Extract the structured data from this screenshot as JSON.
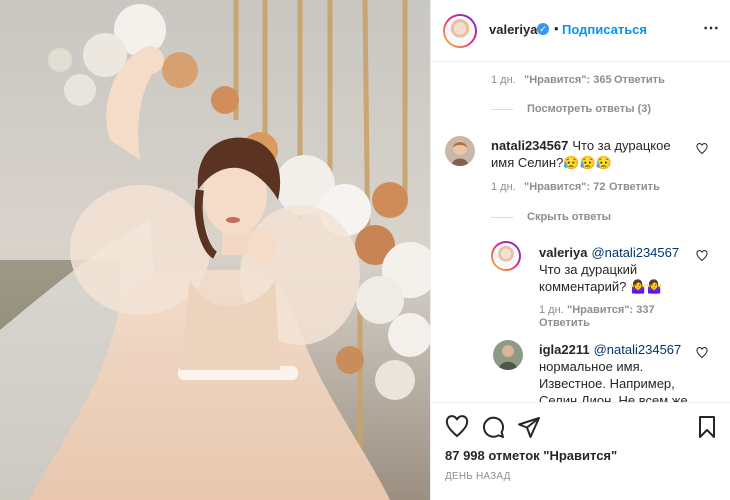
{
  "post": {
    "likes_text": "87 998 отметок \"Нравится\"",
    "time_text": "ДЕНЬ НАЗАД"
  },
  "header": {
    "username": "valeriya",
    "verified_glyph": "✓",
    "separator": "•",
    "follow_label": "Подписаться",
    "more_icon": "more-horizontal-icon"
  },
  "top_thread": {
    "age": "1 дн.",
    "likes": "\"Нравится\": 365",
    "reply": "Ответить",
    "view_replies": "Посмотреть ответы (3)"
  },
  "comments": [
    {
      "username": "natali234567",
      "text": "Что за дурацкое имя Селин?😥😥😥",
      "age": "1 дн.",
      "likes": "\"Нравится\": 72",
      "reply": "Ответить",
      "hide_replies": "Скрыть ответы"
    }
  ],
  "replies": [
    {
      "username": "valeriya",
      "mention": "@natali234567",
      "text": "Что за дурацкий комментарий? 🤷‍♀️🤷‍♀️",
      "age": "1 дн.",
      "likes": "\"Нравится\": 337",
      "reply": "Ответить"
    },
    {
      "username": "igla2211",
      "mention": "@natali234567",
      "text": "нормальное имя. Известное. Например, Селин Дион. Не всем же"
    }
  ],
  "colors": {
    "link": "#0095f6",
    "muted": "#8e8e8e",
    "text": "#262626",
    "mention": "#00376b"
  }
}
